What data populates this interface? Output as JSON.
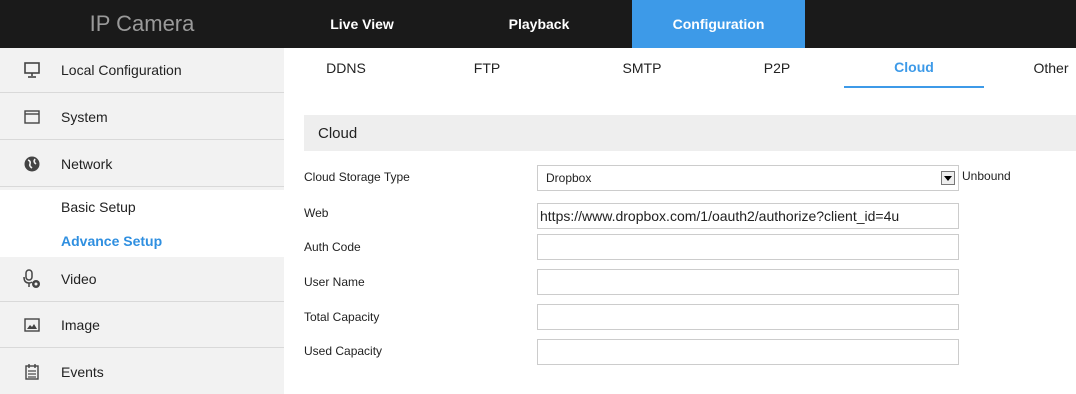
{
  "header": {
    "brand": "IP Camera",
    "nav": [
      {
        "label": "Live View"
      },
      {
        "label": "Playback"
      },
      {
        "label": "Configuration"
      }
    ]
  },
  "sidebar": {
    "items": [
      {
        "label": "Local Configuration",
        "icon": "monitor-icon"
      },
      {
        "label": "System",
        "icon": "window-icon"
      },
      {
        "label": "Network",
        "icon": "globe-icon"
      },
      {
        "label": "Basic Setup"
      },
      {
        "label": "Advance Setup"
      },
      {
        "label": "Video",
        "icon": "microphone-video-icon"
      },
      {
        "label": "Image",
        "icon": "image-icon"
      },
      {
        "label": "Events",
        "icon": "calendar-icon"
      }
    ]
  },
  "tabs": [
    {
      "label": "DDNS"
    },
    {
      "label": "FTP"
    },
    {
      "label": "SMTP"
    },
    {
      "label": "P2P"
    },
    {
      "label": "Cloud"
    },
    {
      "label": "Other"
    }
  ],
  "section": {
    "title": "Cloud"
  },
  "form": {
    "storage_type_label": "Cloud Storage Type",
    "storage_type_value": "Dropbox",
    "status": "Unbound",
    "web_label": "Web",
    "web_value": "https://www.dropbox.com/1/oauth2/authorize?client_id=4u",
    "auth_label": "Auth Code",
    "auth_value": "",
    "user_label": "User Name",
    "user_value": "",
    "total_label": "Total Capacity",
    "total_value": "",
    "used_label": "Used Capacity",
    "used_value": ""
  },
  "colors": {
    "accent": "#3d9ae8",
    "topbar": "#1a1a1a",
    "sidebar": "#f2f2f2"
  }
}
